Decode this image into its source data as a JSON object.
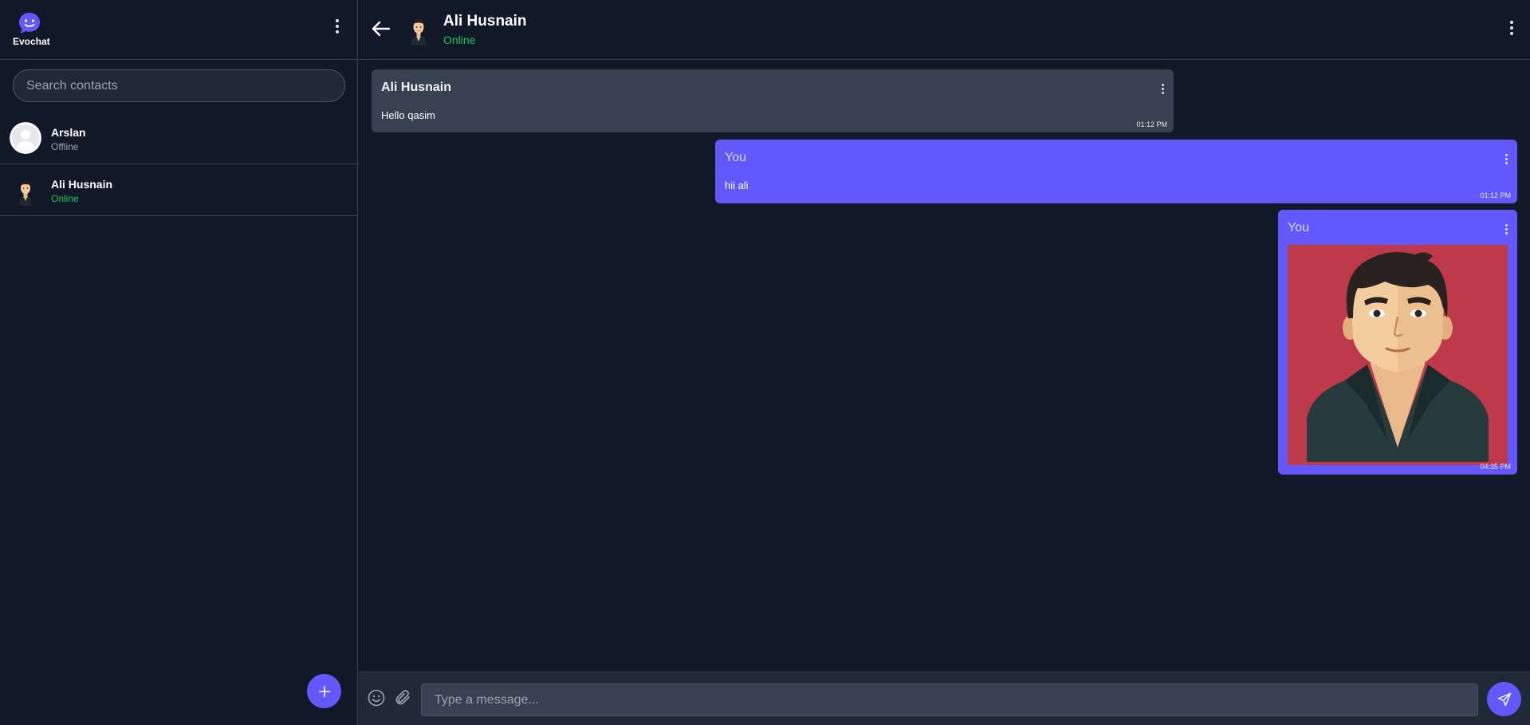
{
  "app": {
    "name": "Evochat"
  },
  "sidebar": {
    "search": {
      "placeholder": "Search contacts",
      "value": ""
    },
    "contacts": [
      {
        "name": "Arslan",
        "status": "Offline",
        "avatar": "default-user-avatar"
      },
      {
        "name": "Ali Husnain",
        "status": "Online",
        "avatar": "man-cartoon-avatar"
      }
    ],
    "fab_icon": "plus-icon"
  },
  "chat": {
    "contact": {
      "name": "Ali Husnain",
      "status": "Online"
    },
    "messages": [
      {
        "author": "Ali Husnain",
        "text": "Hello qasim",
        "time": "01:12 PM",
        "direction": "received"
      },
      {
        "author": "You",
        "text": "hii ali",
        "time": "01:12 PM",
        "direction": "sent"
      },
      {
        "author": "You",
        "image": "man-portrait-illustration",
        "time": "04:35 PM",
        "direction": "sent"
      }
    ]
  },
  "composer": {
    "placeholder": "Type a message...",
    "value": ""
  },
  "colors": {
    "background": "#111827",
    "panel": "#1f2937",
    "received_bubble": "#374151",
    "accent": "#6358fc",
    "online": "#22c55e",
    "image_background": "#be3a4a"
  }
}
